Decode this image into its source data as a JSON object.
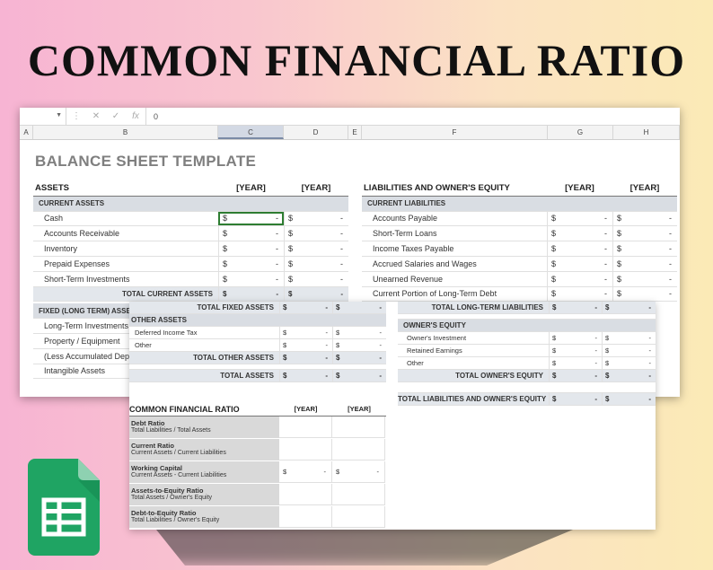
{
  "banner": {
    "title": "COMMON FINANCIAL RATIO"
  },
  "formula_bar": {
    "value": "0",
    "cancel_glyph": "✕",
    "confirm_glyph": "✓",
    "fx": "fx"
  },
  "columns": [
    "A",
    "B",
    "C",
    "D",
    "E",
    "F",
    "G",
    "H"
  ],
  "sheet_title": "BALANCE SHEET TEMPLATE",
  "assets": {
    "header": "ASSETS",
    "years": [
      "[YEAR]",
      "[YEAR]"
    ],
    "current_header": "CURRENT ASSETS",
    "current_items": [
      "Cash",
      "Accounts Receivable",
      "Inventory",
      "Prepaid Expenses",
      "Short-Term Investments"
    ],
    "total_current": "TOTAL CURRENT ASSETS",
    "fixed_header": "FIXED (LONG TERM) ASSE",
    "fixed_items": [
      "Long-Term Investments",
      "Property / Equipment",
      "(Less Accumulated Dep",
      "Intangible Assets"
    ]
  },
  "liabilities": {
    "header": "LIABILITIES AND OWNER'S EQUITY",
    "years": [
      "[YEAR]",
      "[YEAR]"
    ],
    "current_header": "CURRENT LIABILITIES",
    "current_items": [
      "Accounts Payable",
      "Short-Term Loans",
      "Income Taxes Payable",
      "Accrued Salaries and Wages",
      "Unearned Revenue",
      "Current Portion of Long-Term Debt"
    ]
  },
  "money": {
    "symbol": "$",
    "dash": "-"
  },
  "overlay": {
    "total_fixed": "TOTAL FIXED ASSETS",
    "other_header": "OTHER ASSETS",
    "other_items": [
      "Deferred Income Tax",
      "Other"
    ],
    "total_other": "TOTAL OTHER ASSETS",
    "total_assets": "TOTAL ASSETS",
    "total_lt_liab": "TOTAL LONG-TERM LIABILITIES",
    "owners_header": "OWNER'S EQUITY",
    "owners_items": [
      "Owner's Investment",
      "Retained Earnings",
      "Other"
    ],
    "total_owners": "TOTAL OWNER'S EQUITY",
    "total_liab_equity": "TOTAL LIABILITIES AND OWNER'S EQUITY",
    "ratio_title": "COMMON FINANCIAL RATIO",
    "ratio_years": [
      "[YEAR]",
      "[YEAR]"
    ],
    "ratios": [
      {
        "name": "Debt Ratio",
        "formula": "Total Liabilities / Total Assets"
      },
      {
        "name": "Current Ratio",
        "formula": "Current Assets / Current Liabilities"
      },
      {
        "name": "Working Capital",
        "formula": "Current Assets - Current Liabilities"
      },
      {
        "name": "Assets-to-Equity Ratio",
        "formula": "Total Assets / Owner's Equity"
      },
      {
        "name": "Debt-to-Equity Ratio",
        "formula": "Total Liabilities / Owner's Equity"
      }
    ]
  },
  "colors": {
    "header_fill": "#d9dde3",
    "total_fill": "#e3e7ec",
    "active_outline": "#2e7d32",
    "logo_green": "#1fa463"
  },
  "icons": {
    "logo": "google-sheets-icon"
  }
}
